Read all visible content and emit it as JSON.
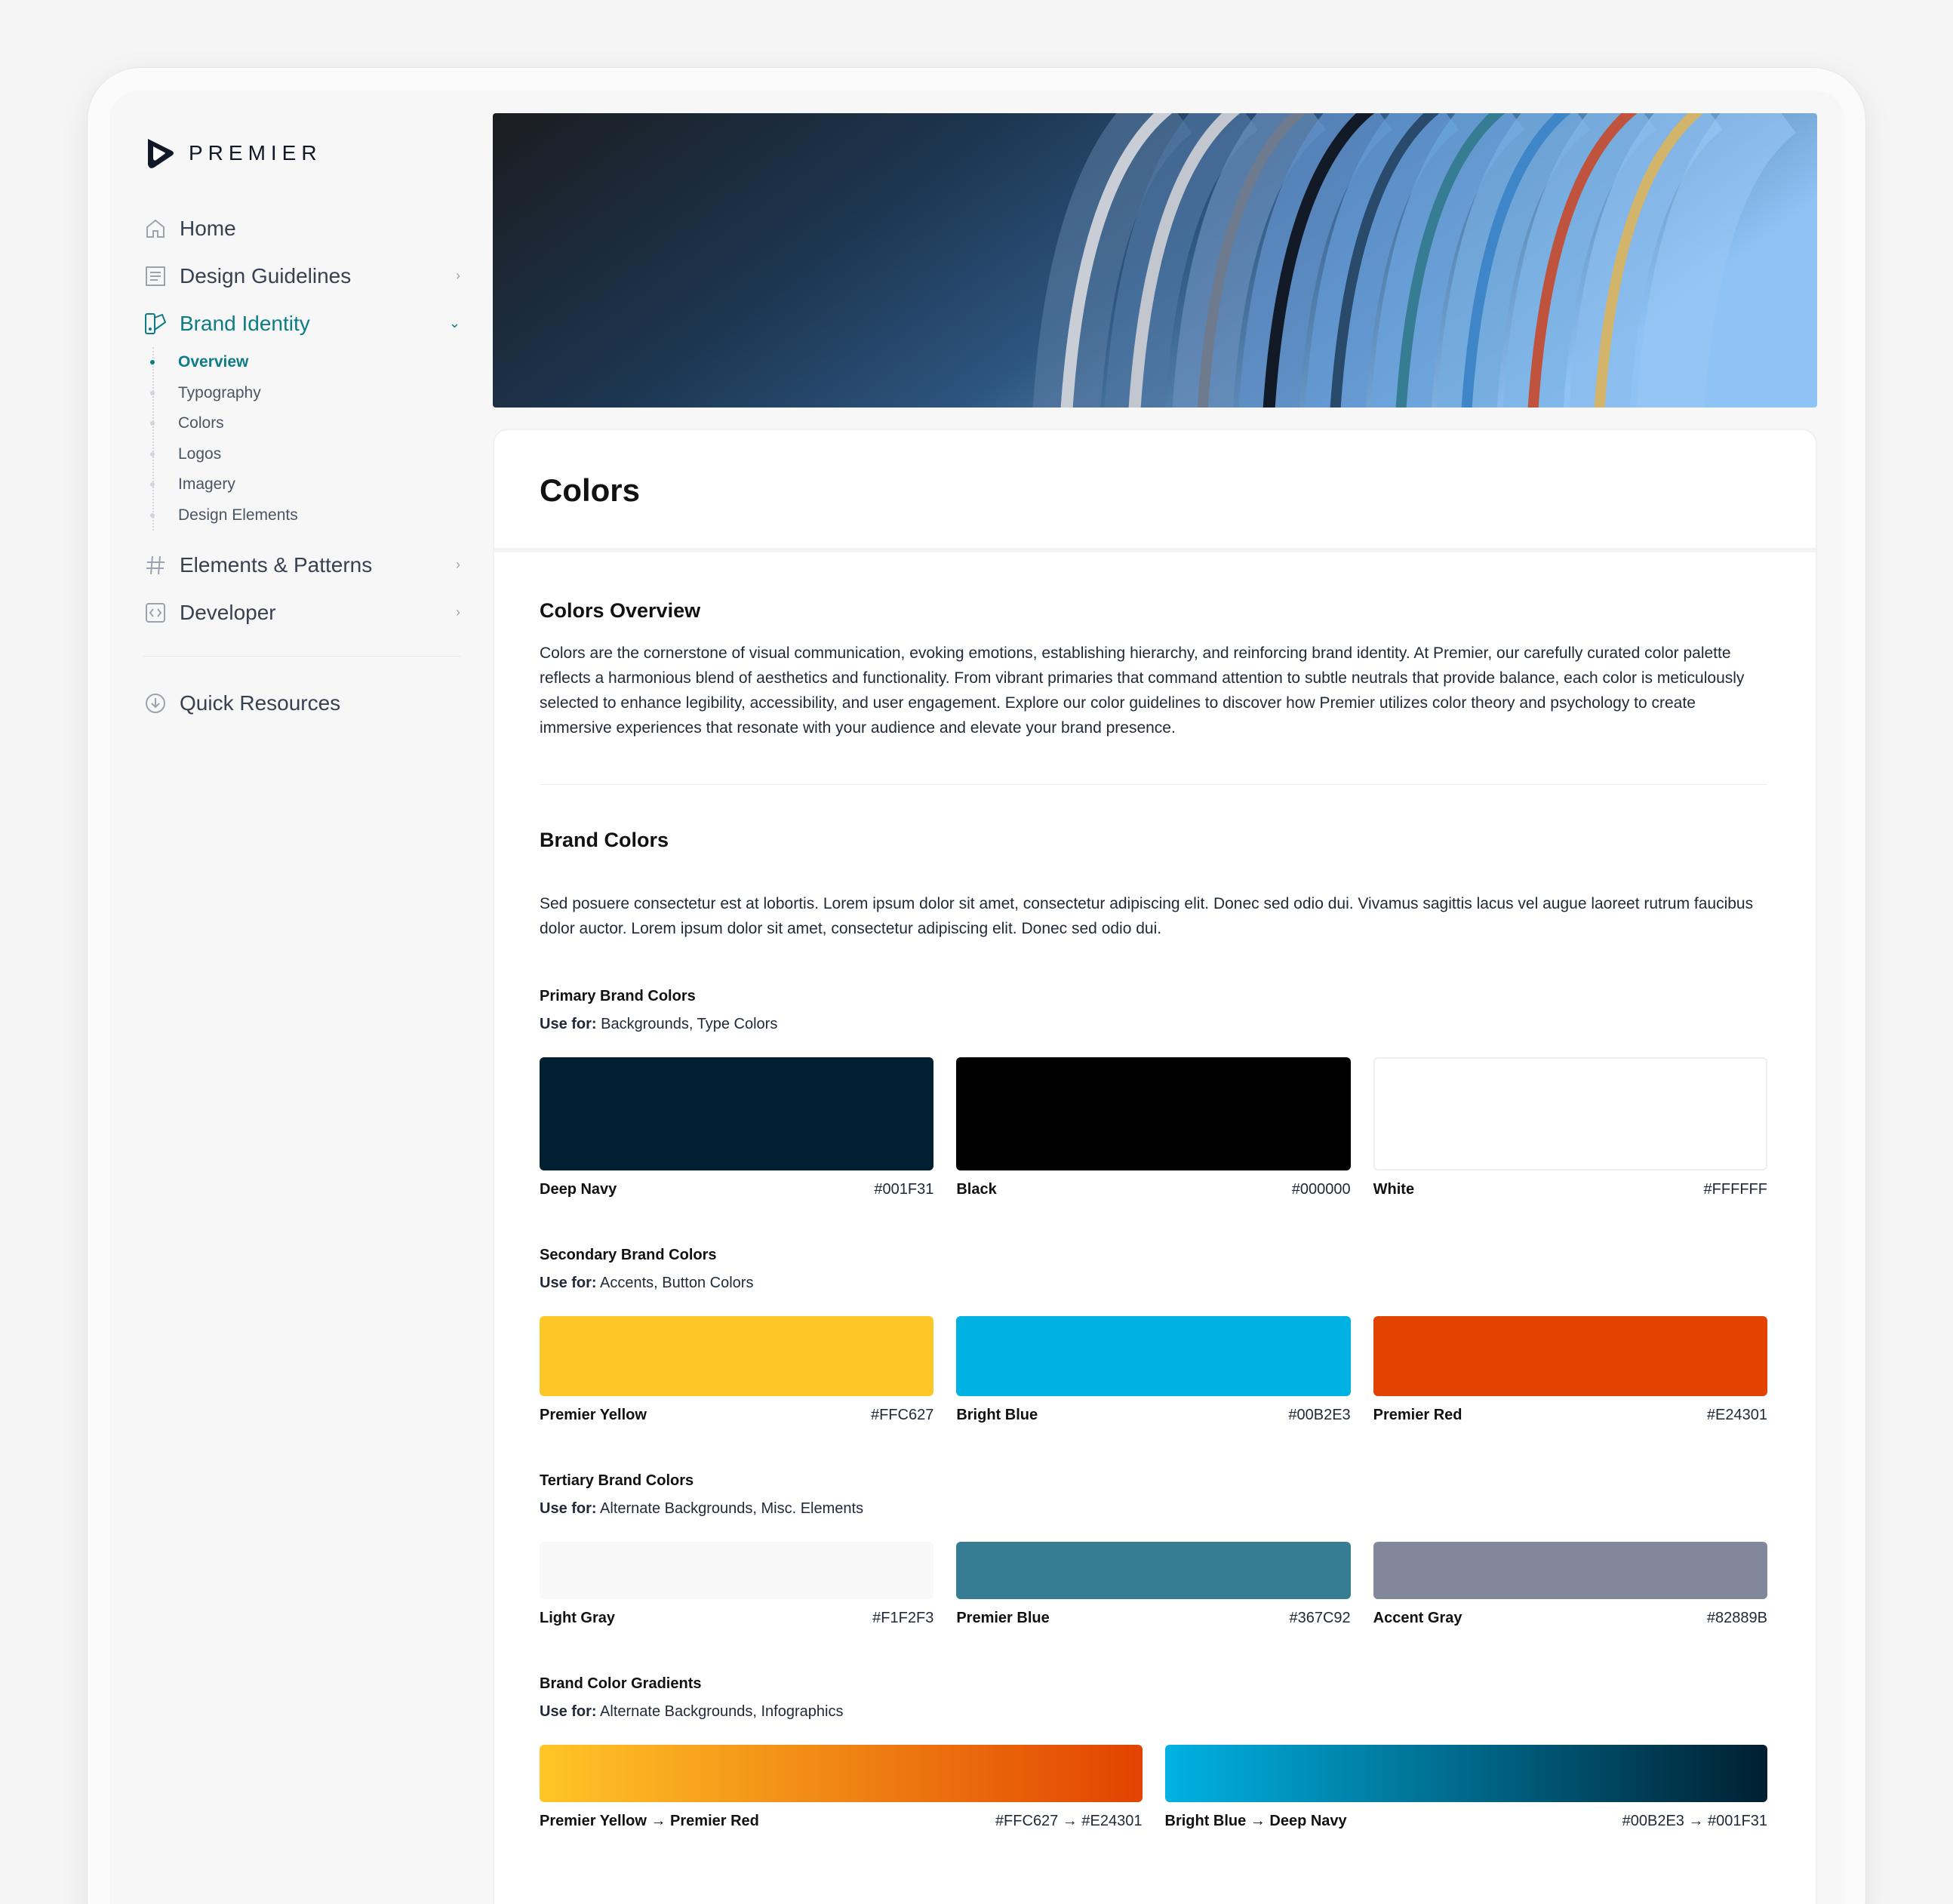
{
  "brand": {
    "name": "PREMIER",
    "mark": "®"
  },
  "sidebar": {
    "items": [
      {
        "label": "Home",
        "icon": "home-icon"
      },
      {
        "label": "Design Guidelines",
        "icon": "document-icon"
      },
      {
        "label": "Brand Identity",
        "icon": "palette-icon"
      }
    ],
    "sub_items": [
      "Overview",
      "Typography",
      "Colors",
      "Logos",
      "Imagery",
      "Design Elements"
    ],
    "items2": [
      {
        "label": "Elements & Patterns",
        "icon": "hash-icon"
      },
      {
        "label": "Developer",
        "icon": "code-icon"
      }
    ],
    "quick_resources": "Quick Resources"
  },
  "page": {
    "title": "Colors",
    "overview_heading": "Colors Overview",
    "overview_text": "Colors are the cornerstone of visual communication, evoking emotions, establishing hierarchy, and reinforcing brand identity. At Premier, our carefully curated color palette reflects a harmonious blend of aesthetics and functionality. From vibrant primaries that command attention to subtle neutrals that provide balance, each color is meticulously selected to enhance legibility, accessibility, and user engagement. Explore our color guidelines to discover how Premier utilizes color theory and psychology to create immersive experiences that resonate with your audience and elevate your brand presence.",
    "brand_heading": "Brand Colors",
    "brand_text": "Sed posuere consectetur est at lobortis. Lorem ipsum dolor sit amet, consectetur adipiscing elit. Donec sed odio dui. Vivamus sagittis lacus vel augue laoreet rutrum faucibus dolor auctor. Lorem ipsum dolor sit amet, consectetur adipiscing elit. Donec sed odio dui.",
    "use_for_prefix": "Use for:"
  },
  "groups": [
    {
      "title": "Primary Brand Colors",
      "use_for": " Backgrounds, Type Colors",
      "colors": [
        {
          "name": "Deep Navy",
          "hex": "#001F31",
          "swatch": "#001F31"
        },
        {
          "name": "Black",
          "hex": "#000000",
          "swatch": "#000000"
        },
        {
          "name": "White",
          "hex": "#FFFFFF",
          "swatch": "#FFFFFF"
        }
      ]
    },
    {
      "title": "Secondary Brand Colors",
      "use_for": " Accents, Button Colors",
      "colors": [
        {
          "name": "Premier Yellow",
          "hex": "#FFC627",
          "swatch": "#FFC627"
        },
        {
          "name": "Bright Blue",
          "hex": "#00B2E3",
          "swatch": "#00B2E3"
        },
        {
          "name": "Premier Red",
          "hex": "#E24301",
          "swatch": "#E24301"
        }
      ]
    },
    {
      "title": "Tertiary Brand Colors",
      "use_for": " Alternate Backgrounds, Misc. Elements",
      "colors": [
        {
          "name": "Light Gray",
          "hex": "#F1F2F3",
          "swatch": "#F8F8F8"
        },
        {
          "name": "Premier Blue",
          "hex": "#367C92",
          "swatch": "#367C92"
        },
        {
          "name": "Accent Gray",
          "hex": "#82889B",
          "swatch": "#82889B"
        }
      ]
    },
    {
      "title": "Brand Color Gradients",
      "use_for": " Alternate Backgrounds, Infographics",
      "gradients": [
        {
          "name": "Premier Yellow → Premier Red",
          "hex": "#FFC627 → #E24301",
          "from": "#FFC627",
          "to": "#E24301"
        },
        {
          "name": "Bright Blue → Deep Navy",
          "hex": "#00B2E3 → #001F31",
          "from": "#00B2E3",
          "to": "#001F31"
        }
      ]
    }
  ],
  "colors": {
    "accent": "#0E7C86"
  }
}
